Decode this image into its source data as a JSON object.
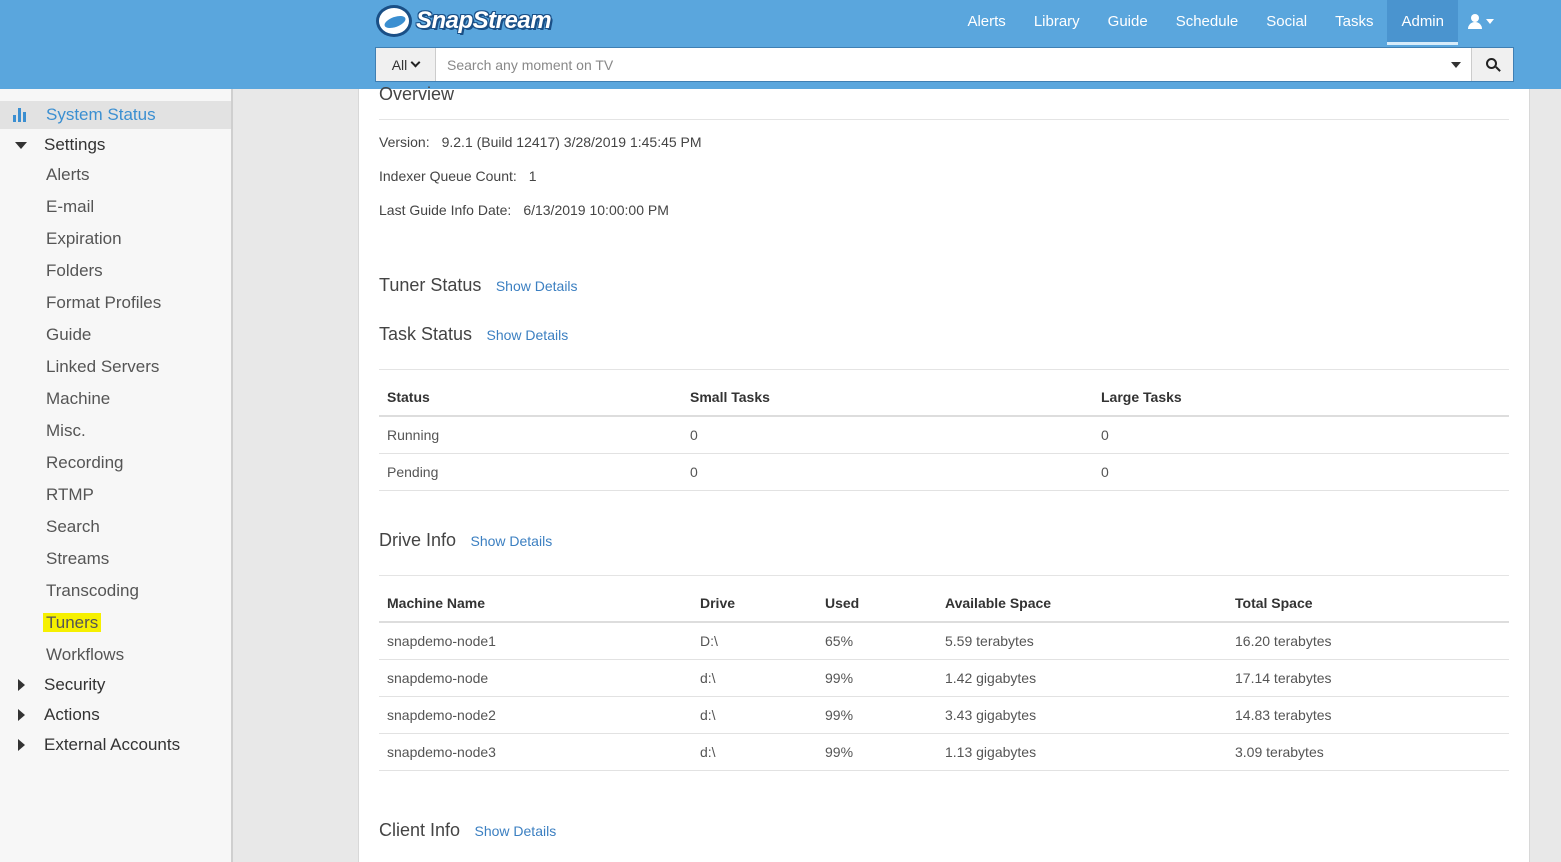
{
  "app": {
    "brand": "SnapStream"
  },
  "nav": {
    "items": [
      "Alerts",
      "Library",
      "Guide",
      "Schedule",
      "Social",
      "Tasks",
      "Admin"
    ],
    "active": "Admin"
  },
  "search": {
    "scope": "All",
    "placeholder": "Search any moment on TV"
  },
  "sidebar": {
    "system_status": "System Status",
    "settings": "Settings",
    "settings_items": [
      "Alerts",
      "E-mail",
      "Expiration",
      "Folders",
      "Format Profiles",
      "Guide",
      "Linked Servers",
      "Machine",
      "Misc.",
      "Recording",
      "RTMP",
      "Search",
      "Streams",
      "Transcoding",
      "Tuners",
      "Workflows"
    ],
    "highlighted_item": "Tuners",
    "collapsed_groups": [
      "Security",
      "Actions",
      "External Accounts"
    ]
  },
  "overview": {
    "title": "Overview",
    "version_label": "Version:",
    "version_value": "9.2.1 (Build 12417) 3/28/2019 1:45:45 PM",
    "queue_label": "Indexer Queue Count:",
    "queue_value": "1",
    "guide_label": "Last Guide Info Date:",
    "guide_value": "6/13/2019 10:00:00 PM"
  },
  "tuner_status": {
    "title": "Tuner Status",
    "link": "Show Details"
  },
  "task_status": {
    "title": "Task Status",
    "link": "Show Details",
    "columns": [
      "Status",
      "Small Tasks",
      "Large Tasks"
    ],
    "rows": [
      [
        "Running",
        "0",
        "0"
      ],
      [
        "Pending",
        "0",
        "0"
      ]
    ]
  },
  "drive_info": {
    "title": "Drive Info",
    "link": "Show Details",
    "columns": [
      "Machine Name",
      "Drive",
      "Used",
      "Available Space",
      "Total Space"
    ],
    "rows": [
      [
        "snapdemo-node1",
        "D:\\",
        "65%",
        "5.59 terabytes",
        "16.20 terabytes"
      ],
      [
        "snapdemo-node",
        "d:\\",
        "99%",
        "1.42 gigabytes",
        "17.14 terabytes"
      ],
      [
        "snapdemo-node2",
        "d:\\",
        "99%",
        "3.43 gigabytes",
        "14.83 terabytes"
      ],
      [
        "snapdemo-node3",
        "d:\\",
        "99%",
        "1.13 gigabytes",
        "3.09 terabytes"
      ]
    ]
  },
  "client_info": {
    "title": "Client Info",
    "link": "Show Details"
  },
  "colors": {
    "header": "#5aa6dd",
    "accent": "#3b8fd1",
    "highlight": "#f6f000"
  }
}
